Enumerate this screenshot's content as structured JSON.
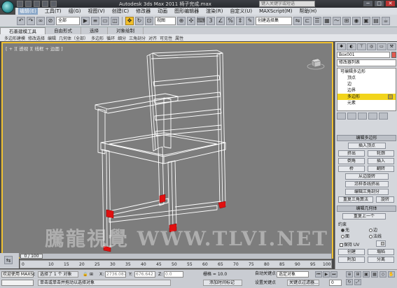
{
  "app": {
    "window_title": "Autodesk 3ds Max  2011     椅子完成.max",
    "search_placeholder": "键入关键字或短语"
  },
  "window_controls": {
    "minimize": "─",
    "maximize": "□",
    "close": "✕"
  },
  "menubar": {
    "items": [
      "编辑(E)",
      "工具(T)",
      "组(G)",
      "视图(V)",
      "创建(C)",
      "修改器",
      "动画",
      "图形编辑器",
      "渲染(R)",
      "自定义(U)",
      "MAXScript(M)",
      "帮助(H)"
    ]
  },
  "toolbar": {
    "selection_filter": "全部",
    "reference_coord": "视图",
    "named_selection": "创建选择集"
  },
  "ribbon": {
    "tabs": [
      "石墨建模工具",
      "自由形式",
      "选择",
      "对象绘制"
    ],
    "subtools": [
      "多边形建模",
      "修改选择",
      "编辑",
      "几何体（全部）",
      "多边形",
      "循环",
      "细分",
      "三角剖分",
      "对齐",
      "可见性",
      "属性"
    ]
  },
  "viewport": {
    "label": "[ + ][ 透视 ][ 线框 + 边面 ]",
    "watermark": "騰龍視覺 WWW.TLVI.NET"
  },
  "command_panel": {
    "object_name": "Box001",
    "modifier_list": "修改器列表",
    "stack": [
      {
        "label": "可编辑多边形",
        "level": 0,
        "selected": false
      },
      {
        "label": "顶点",
        "level": 1,
        "selected": false
      },
      {
        "label": "边",
        "level": 1,
        "selected": false
      },
      {
        "label": "边界",
        "level": 1,
        "selected": false
      },
      {
        "label": "多边形",
        "level": 1,
        "selected": true
      },
      {
        "label": "元素",
        "level": 1,
        "selected": false
      }
    ],
    "edit_polygons": {
      "header": "编辑多边形",
      "insert_vertex": "插入顶点",
      "extrude": "挤出",
      "outline": "轮廓",
      "bevel": "倒角",
      "inset": "插入",
      "bridge": "桥",
      "flip": "翻转",
      "hinge": "从边旋转",
      "extrude_spline": "沿样条线挤出",
      "edit_triangulation": "编辑三角剖分",
      "retriangulate": "重复三角算法",
      "turn": "旋转"
    },
    "edit_geometry": {
      "header": "编辑几何体",
      "repeat_last": "重复上一个",
      "constraints_label": "约束",
      "constraint_none": "无",
      "constraint_edge": "边",
      "constraint_face": "面",
      "constraint_normal": "法线",
      "preserve_uvs": "保持 UV",
      "create": "创建",
      "collapse": "塌陷",
      "attach": "附加",
      "detach": "分离"
    }
  },
  "time": {
    "slider_label": "0 / 100",
    "ticks": [
      "0",
      "10",
      "15",
      "20",
      "25",
      "30",
      "35",
      "40",
      "45",
      "50",
      "55",
      "60",
      "65",
      "70",
      "75",
      "80",
      "85",
      "90",
      "95",
      "100"
    ]
  },
  "status": {
    "maxscript_label": "欢迎使用 MAXSc",
    "selection": "选择了 1 个 对象",
    "prompt": "单击或单击并拖动以选择对象",
    "x_label": "X:",
    "x_value": "2736.087",
    "y_label": "Y:",
    "y_value": "676.642",
    "z_label": "Z:",
    "z_value": "0.0",
    "grid": "栅格 = 10.0",
    "add_time_tag": "添加时间标记",
    "auto_key": "自动关键点",
    "auto_key_mode": "选定对象",
    "set_key": "设置关键点",
    "key_filters": "关键点过滤器...",
    "frame": "0"
  },
  "colors": {
    "viewport_bg": "#7d7d7d",
    "viewport_border": "#f1c232",
    "selected_stack": "#f2d41b",
    "object_color": "#e05a50",
    "polygon_select": "#e01010"
  }
}
